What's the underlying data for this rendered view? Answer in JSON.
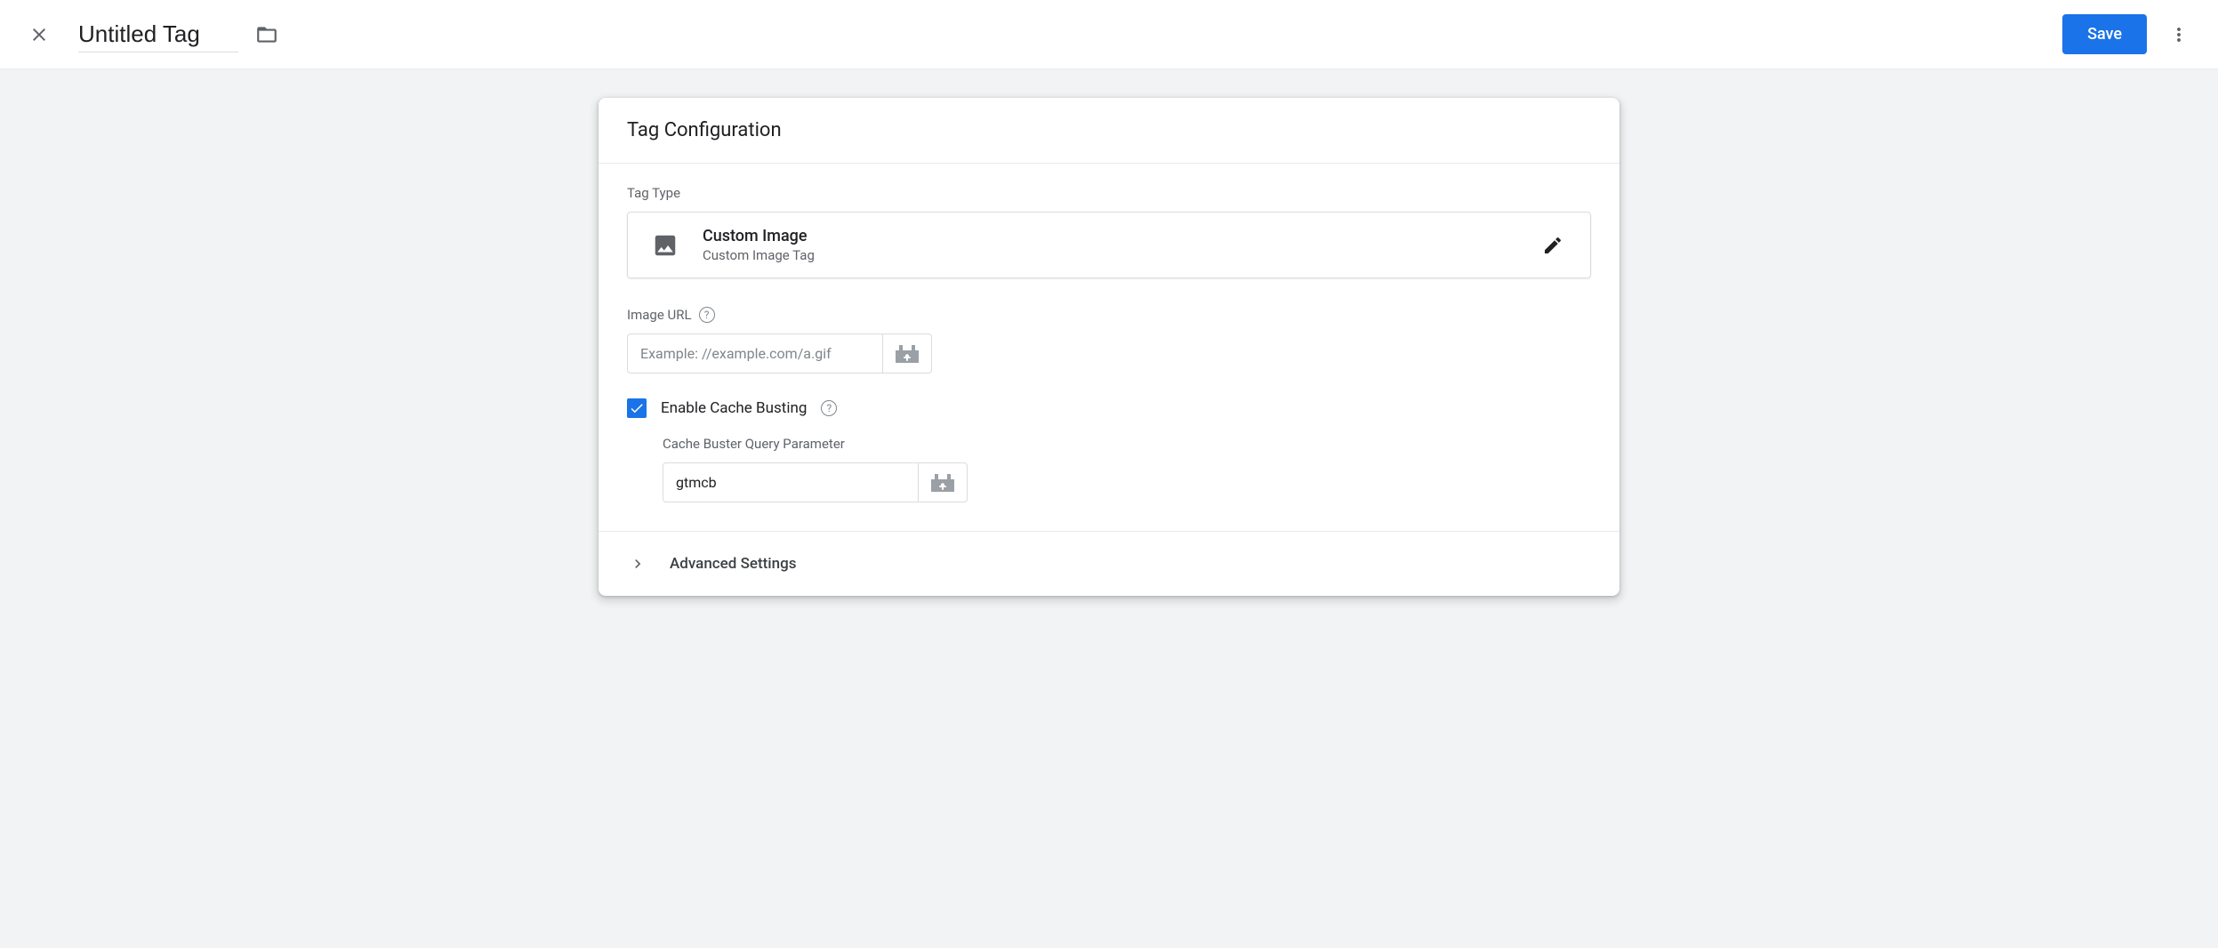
{
  "header": {
    "title": "Untitled Tag",
    "save_label": "Save"
  },
  "card": {
    "title": "Tag Configuration",
    "tag_type_label": "Tag Type",
    "tag_type": {
      "name": "Custom Image",
      "description": "Custom Image Tag"
    },
    "image_url": {
      "label": "Image URL",
      "placeholder": "Example: //example.com/a.gif",
      "value": ""
    },
    "cache_busting": {
      "label": "Enable Cache Busting",
      "checked": true,
      "param_label": "Cache Buster Query Parameter",
      "param_value": "gtmcb"
    },
    "advanced_label": "Advanced Settings"
  }
}
